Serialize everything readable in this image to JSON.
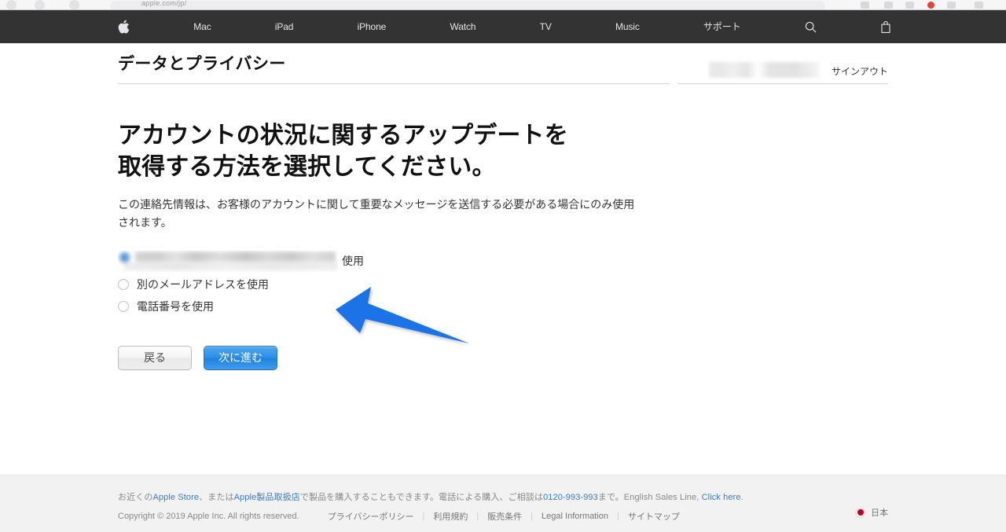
{
  "browser": {
    "omnibox_text": "apple.com/jp/",
    "traffic_icons": [
      "back-icon",
      "forward-icon",
      "reload-icon"
    ]
  },
  "globalnav": {
    "apple_logo_label": "Apple",
    "items": [
      {
        "label": "Mac",
        "name": "globalnav-item-mac"
      },
      {
        "label": "iPad",
        "name": "globalnav-item-ipad"
      },
      {
        "label": "iPhone",
        "name": "globalnav-item-iphone"
      },
      {
        "label": "Watch",
        "name": "globalnav-item-watch"
      },
      {
        "label": "TV",
        "name": "globalnav-item-tv"
      },
      {
        "label": "Music",
        "name": "globalnav-item-music"
      },
      {
        "label": "サポート",
        "name": "globalnav-item-support"
      }
    ],
    "search_icon": "search-icon",
    "bag_icon": "shopping-bag-icon"
  },
  "page_head": {
    "title": "データとプライバシー",
    "user_name_redacted": "",
    "signout_label": "サインアウト"
  },
  "main": {
    "heading_line1": "アカウントの状況に関するアップデートを",
    "heading_line2": "取得する方法を選択してください。",
    "body_text": "この連絡先情報は、お客様のアカウントに関して重要なメッセージを送信する必要がある場合にのみ使用されます。",
    "options": [
      {
        "label": "",
        "suffix": "使用",
        "selected": true,
        "redacted": true,
        "name": "radio-option-current-email"
      },
      {
        "label": "別のメールアドレスを使用",
        "suffix": "",
        "selected": false,
        "redacted": false,
        "name": "radio-option-other-email"
      },
      {
        "label": "電話番号を使用",
        "suffix": "",
        "selected": false,
        "redacted": false,
        "name": "radio-option-phone"
      }
    ],
    "back_button": "戻る",
    "next_button": "次に進む"
  },
  "annotation": {
    "arrow_color": "#1a73e8",
    "arrow_direction": "left"
  },
  "footer": {
    "line1": {
      "part1": "お近くの",
      "link1": "Apple Store",
      "part2": "、または",
      "link2": "Apple製品取扱店",
      "part3": "で製品を購入することもできます。電話による購入、ご相談は",
      "link3": "0120-993-993",
      "part4": "まで。English Sales Line, ",
      "link4": "Click here",
      "part5": "."
    },
    "copyright": "Copyright © 2019 Apple Inc. All rights reserved.",
    "nav_links": [
      "プライバシーポリシー",
      "利用規約",
      "販売条件",
      "Legal Information",
      "サイトマップ"
    ],
    "country": "日本",
    "country_flag": "japan-flag-icon"
  },
  "colors": {
    "nav_bg": "#333333",
    "accent_blue": "#2e8fe6",
    "footer_bg": "#f2f2f2",
    "link_blue": "#3b7bbf"
  }
}
